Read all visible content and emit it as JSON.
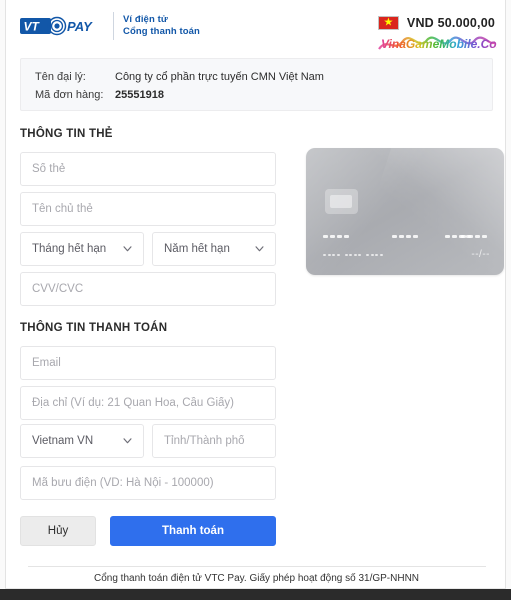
{
  "header": {
    "logo_text": "VTC PAY",
    "tagline_line1": "Ví điện tử",
    "tagline_line2": "Cổng thanh toán",
    "currency_amount": "VND  50.000,00",
    "flag_icon": "vietnam-flag-icon",
    "flag_star": "★",
    "watermark": "VinaGameMobile.Com"
  },
  "merchant": {
    "rows": [
      {
        "label": "Tên đại lý:",
        "value": "Công ty cổ phần trực tuyến CMN Việt Nam"
      },
      {
        "label": "Mã đơn hàng:",
        "value": "25551918"
      }
    ]
  },
  "card_section": {
    "title": "THÔNG TIN THẺ",
    "fields": {
      "card_number": {
        "placeholder": "Số thẻ",
        "value": ""
      },
      "card_holder": {
        "placeholder": "Tên chủ thẻ",
        "value": ""
      },
      "exp_month": {
        "placeholder": "Tháng hết hạn",
        "value": ""
      },
      "exp_year": {
        "placeholder": "Năm hết hạn",
        "value": ""
      },
      "cvv": {
        "placeholder": "CVV/CVC",
        "value": ""
      }
    }
  },
  "card_art": {
    "expiry_placeholder": "--/--"
  },
  "payment_section": {
    "title": "THÔNG TIN THANH TOÁN",
    "fields": {
      "email": {
        "placeholder": "Email",
        "value": ""
      },
      "address": {
        "placeholder": "Địa chỉ (Ví dụ: 21 Quan Hoa, Cầu Giấy)",
        "value": ""
      },
      "country": {
        "placeholder": "Vietnam VN",
        "value": "Vietnam VN"
      },
      "city": {
        "placeholder": "Tỉnh/Thành phố",
        "value": ""
      },
      "zip": {
        "placeholder": "Mã bưu điện (VD: Hà Nội - 100000)",
        "value": ""
      }
    }
  },
  "actions": {
    "cancel_label": "Hủy",
    "pay_label": "Thanh toán",
    "pay_color": "#2f6fed",
    "cancel_color": "#ececec"
  },
  "footer": {
    "text": "Cổng thanh toán điện tử VTC Pay. Giấy phép hoạt động số 31/GP-NHNN"
  }
}
